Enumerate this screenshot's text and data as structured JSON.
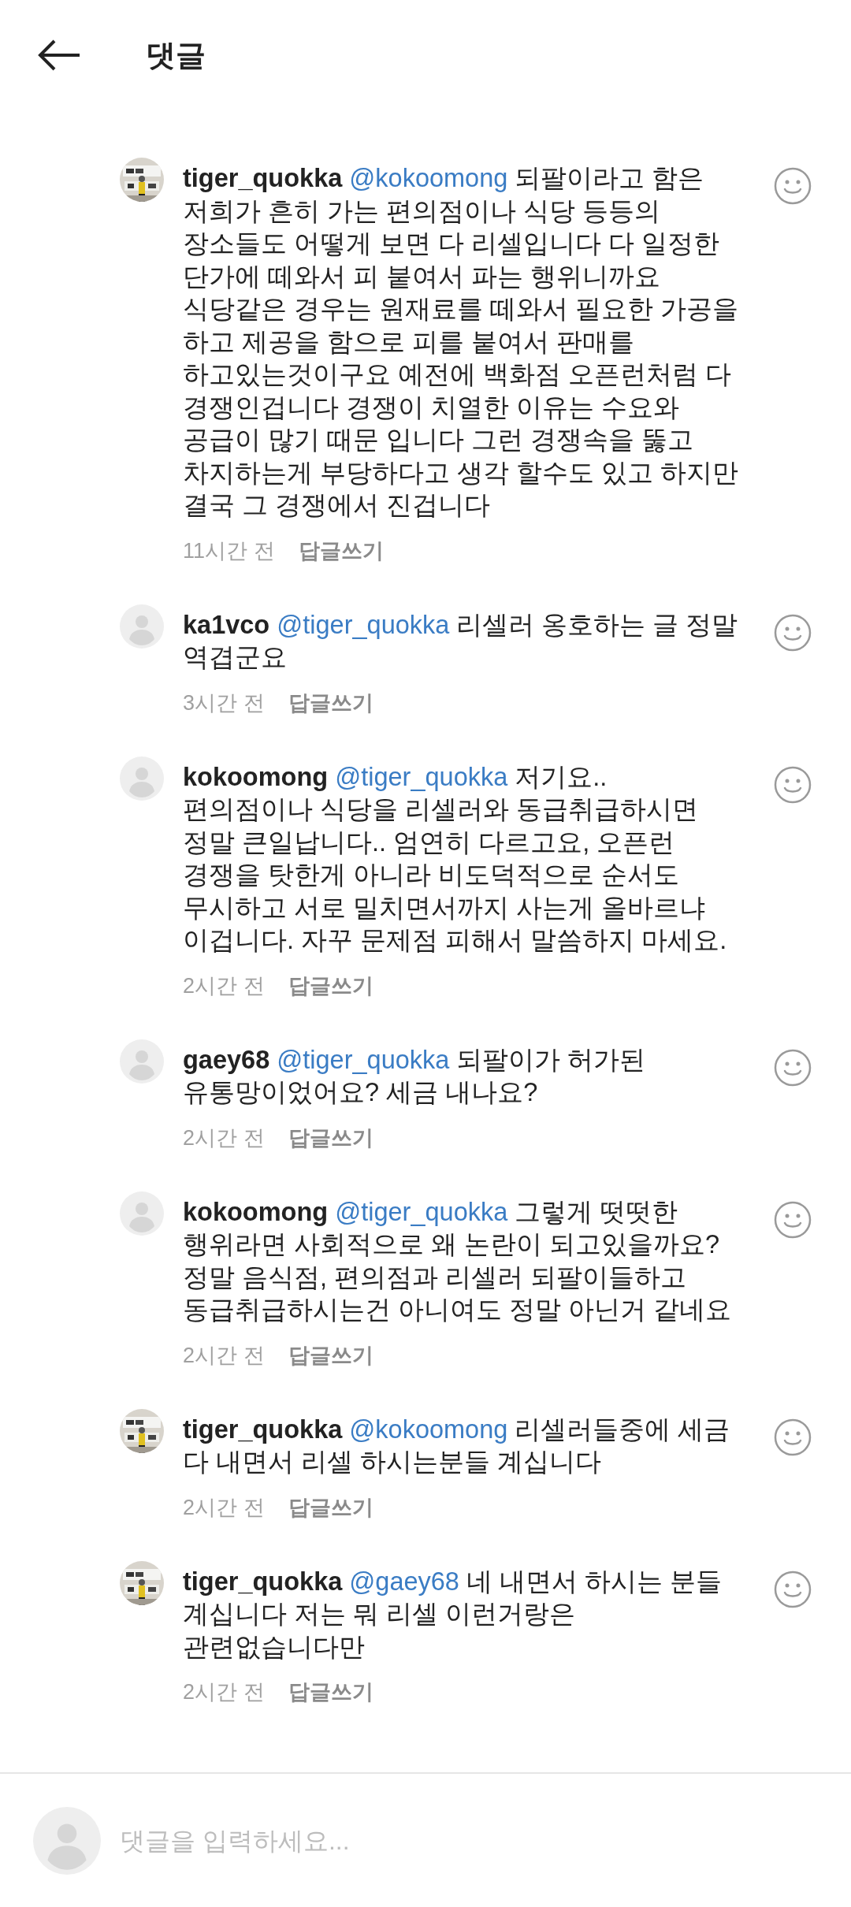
{
  "header": {
    "title": "댓글"
  },
  "comments": [
    {
      "user": "tiger_quokka",
      "mention": "@kokoomong",
      "text": "되팔이라고 함은 저희가 흔히 가는 편의점이나 식당 등등의 장소들도 어떻게 보면 다 리셀입니다 다 일정한 단가에 떼와서 피 붙여서 파는 행위니까요 식당같은 경우는 원재료를 떼와서 필요한 가공을 하고 제공을 함으로 피를 붙여서 판매를 하고있는것이구요 예전에 백화점 오픈런처럼 다 경쟁인겁니다 경쟁이 치열한 이유는 수요와 공급이 많기 때문 입니다 그런 경쟁속을 뚫고 차지하는게 부당하다고 생각 할수도 있고 하지만 결국 그 경쟁에서 진겁니다",
      "time": "11시간 전",
      "reply": "답글쓰기"
    },
    {
      "user": "ka1vco",
      "avatar": {
        "kind": "default"
      },
      "mention": "@tiger_quokka",
      "text": "리셀러 옹호하는 글 정말 역겹군요",
      "time": "3시간 전",
      "reply": "답글쓰기"
    },
    {
      "user": "kokoomong",
      "avatar": {
        "kind": "default"
      },
      "mention": "@tiger_quokka",
      "text": "저기요.. 편의점이나 식당을 리셀러와 동급취급하시면 정말 큰일납니다.. 엄연히 다르고요, 오픈런 경쟁을 탓한게 아니라 비도덕적으로 순서도 무시하고 서로 밀치면서까지 사는게 올바르냐 이겁니다. 자꾸 문제점 피해서 말씀하지 마세요.",
      "time": "2시간 전",
      "reply": "답글쓰기"
    },
    {
      "user": "gaey68",
      "avatar": {
        "kind": "default"
      },
      "mention": "@tiger_quokka",
      "text": "되팔이가 허가된 유통망이었어요? 세금 내나요?",
      "time": "2시간 전",
      "reply": "답글쓰기"
    },
    {
      "user": "kokoomong",
      "avatar": {
        "kind": "default"
      },
      "mention": "@tiger_quokka",
      "text": "그렇게 떳떳한 행위라면 사회적으로 왜 논란이 되고있을까요? 정말 음식점, 편의점과 리셀러 되팔이들하고 동급취급하시는건 아니여도 정말 아닌거 같네요",
      "time": "2시간 전",
      "reply": "답글쓰기"
    },
    {
      "user": "tiger_quokka",
      "mention": "@kokoomong",
      "text": "리셀러들중에 세금 다 내면서 리셀 하시는분들 계십니다",
      "time": "2시간 전",
      "reply": "답글쓰기"
    },
    {
      "user": "tiger_quokka",
      "mention": "@gaey68",
      "text": "네 내면서 하시는 분들 계십니다 저는 뭐 리셀 이런거랑은 관련없습니다만",
      "time": "2시간 전",
      "reply": "답글쓰기"
    }
  ],
  "input": {
    "placeholder": "댓글을 입력하세요..."
  }
}
